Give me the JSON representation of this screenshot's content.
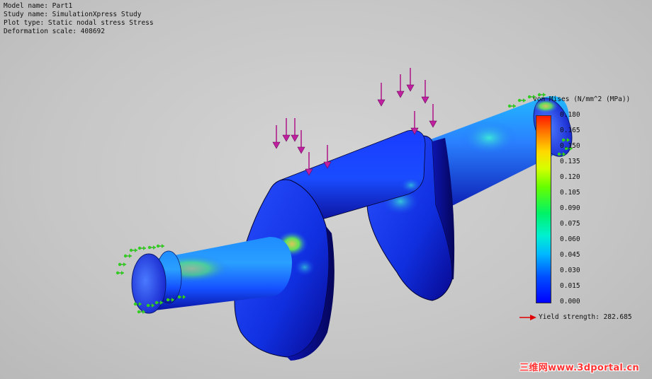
{
  "plot_info": {
    "model_name": "Model name: Part1",
    "study_name": "Study name: SimulationXpress Study",
    "plot_type": "Plot type: Static nodal stress Stress",
    "deformation_scale": "Deformation scale: 408692"
  },
  "legend": {
    "title": "von Mises (N/mm^2 (MPa))",
    "ticks": [
      "0.180",
      "0.165",
      "0.150",
      "0.135",
      "0.120",
      "0.105",
      "0.090",
      "0.075",
      "0.060",
      "0.045",
      "0.030",
      "0.015",
      "0.000"
    ],
    "yield_strength": "Yield strength: 282.685",
    "colors": {
      "max": "#ff1a00",
      "mid": "#66ff00",
      "min": "#0000ff",
      "yield_arrow": "#e00000"
    }
  },
  "model": {
    "fixture_color": "#33cc22",
    "load_color": "#b0208c"
  },
  "watermark": "三维网www.3dportal.cn"
}
